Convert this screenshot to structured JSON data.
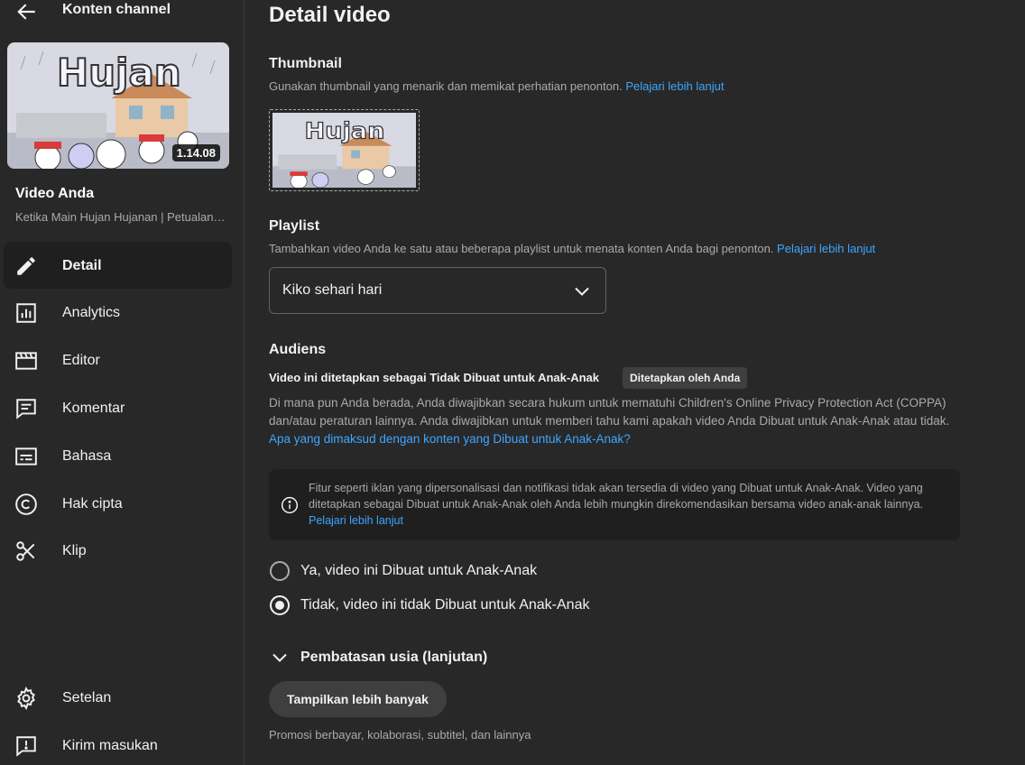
{
  "sidebar": {
    "header_title": "Konten channel",
    "duration": "1.14.08",
    "your_video_label": "Video Anda",
    "video_title": "Ketika Main Hujan Hujanan | Petualangan Kiko",
    "nav": [
      {
        "label": "Detail",
        "icon": "pencil-icon",
        "active": true
      },
      {
        "label": "Analytics",
        "icon": "analytics-icon"
      },
      {
        "label": "Editor",
        "icon": "clapperboard-icon"
      },
      {
        "label": "Komentar",
        "icon": "comment-icon"
      },
      {
        "label": "Bahasa",
        "icon": "subtitles-icon"
      },
      {
        "label": "Hak cipta",
        "icon": "copyright-icon"
      },
      {
        "label": "Klip",
        "icon": "scissors-icon"
      }
    ],
    "bottom": [
      {
        "label": "Setelan",
        "icon": "gear-icon"
      },
      {
        "label": "Kirim masukan",
        "icon": "feedback-icon"
      }
    ]
  },
  "main": {
    "page_title": "Detail video",
    "thumbnail": {
      "title": "Thumbnail",
      "desc": "Gunakan thumbnail yang menarik dan memikat perhatian penonton.",
      "link": "Pelajari lebih lanjut",
      "thumb_text": "Hujan"
    },
    "playlist": {
      "title": "Playlist",
      "desc": "Tambahkan video Anda ke satu atau beberapa playlist untuk menata konten Anda bagi penonton.",
      "link": "Pelajari lebih lanjut",
      "selected": "Kiko sehari hari"
    },
    "audience": {
      "title": "Audiens",
      "subtitle": "Video ini ditetapkan sebagai Tidak Dibuat untuk Anak-Anak",
      "badge": "Ditetapkan oleh Anda",
      "desc": "Di mana pun Anda berada, Anda diwajibkan secara hukum untuk mematuhi Children's Online Privacy Protection Act (COPPA) dan/atau peraturan lainnya. Anda diwajibkan untuk memberi tahu kami apakah video Anda Dibuat untuk Anak-Anak atau tidak.",
      "desc_link": "Apa yang dimaksud dengan konten yang Dibuat untuk Anak-Anak?",
      "info": "Fitur seperti iklan yang dipersonalisasi dan notifikasi tidak akan tersedia di video yang Dibuat untuk Anak-Anak. Video yang ditetapkan sebagai Dibuat untuk Anak-Anak oleh Anda lebih mungkin direkomendasikan bersama video anak-anak lainnya.",
      "info_link": "Pelajari lebih lanjut",
      "option_yes": "Ya, video ini Dibuat untuk Anak-Anak",
      "option_no": "Tidak, video ini tidak Dibuat untuk Anak-Anak",
      "selected": "no"
    },
    "age_restriction": "Pembatasan usia (lanjutan)",
    "show_more": "Tampilkan lebih banyak",
    "show_more_desc": "Promosi berbayar, kolaborasi, subtitel, dan lainnya"
  },
  "colors": {
    "background": "#282828",
    "link": "#3ea6ff",
    "secondary_text": "#aaaaaa",
    "active_nav": "#1f1f1f"
  }
}
